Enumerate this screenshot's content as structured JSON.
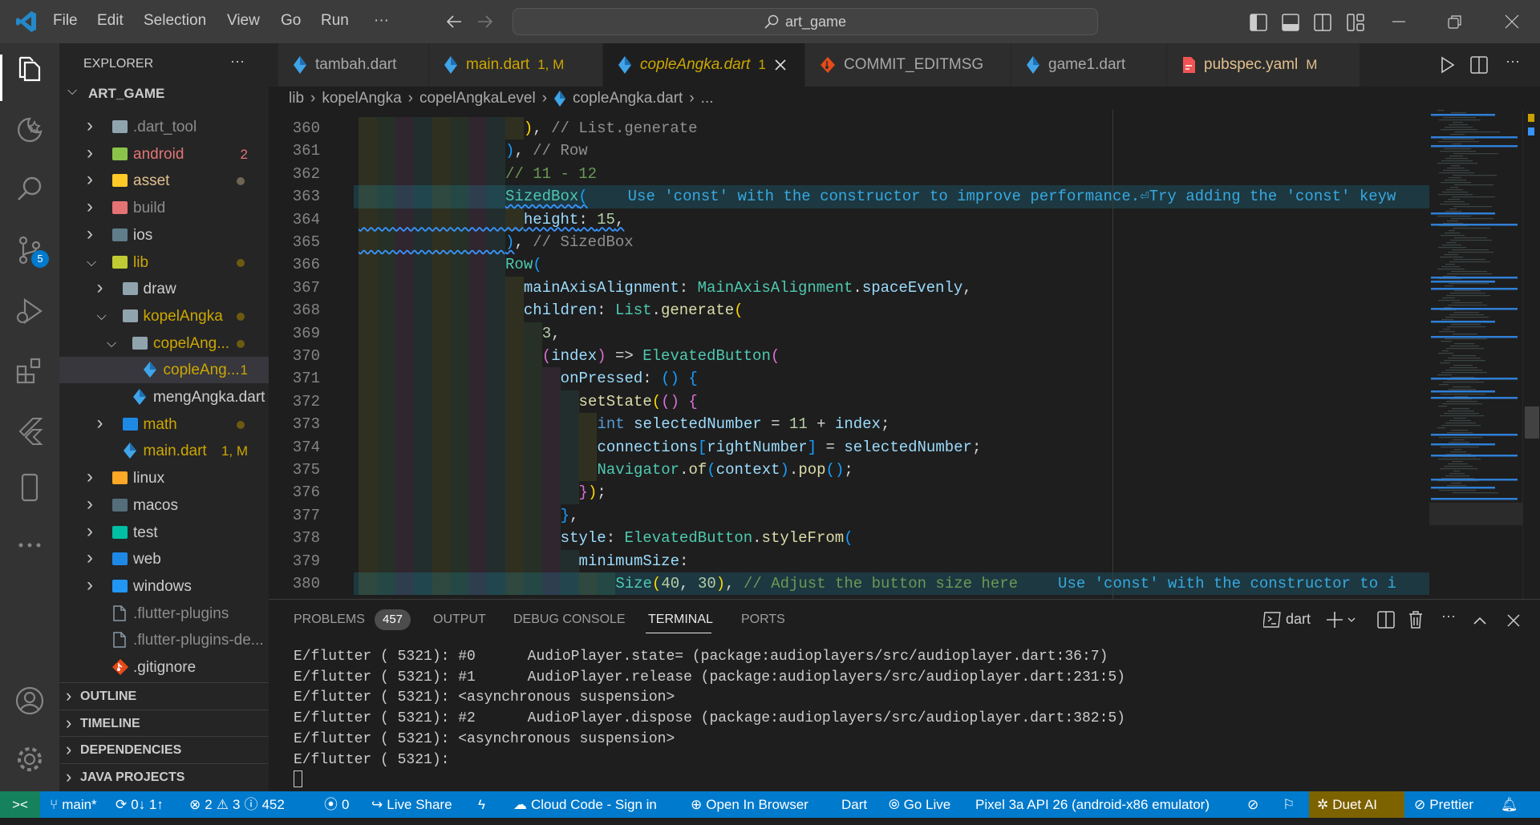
{
  "title_bar": {
    "menu": [
      "File",
      "Edit",
      "Selection",
      "View",
      "Go",
      "Run",
      "···"
    ],
    "search_text": "art_game",
    "icons": [
      "back-arrow-icon",
      "forward-arrow-icon",
      "toggle-primary-sidebar-icon",
      "toggle-panel-icon",
      "toggle-secondary-sidebar-icon",
      "customize-layout-icon",
      "minimize-icon",
      "restore-icon",
      "close-icon"
    ]
  },
  "activity_bar": {
    "items": [
      {
        "icon": "explorer-icon",
        "active": true
      },
      {
        "icon": "remote-explorer-icon"
      },
      {
        "icon": "search-icon"
      },
      {
        "icon": "source-control-icon",
        "badge": "5"
      },
      {
        "icon": "run-debug-icon"
      },
      {
        "icon": "extensions-icon"
      },
      {
        "icon": "flutter-icon"
      },
      {
        "icon": "device-icon"
      },
      {
        "icon": "more-icon"
      },
      {
        "icon": "account-icon"
      },
      {
        "icon": "settings-gear-icon"
      }
    ]
  },
  "sidebar": {
    "title": "EXPLORER",
    "more": "···",
    "root": "ART_GAME",
    "tree": [
      {
        "label": ".dart_tool",
        "level": 0,
        "type": "folder",
        "expanded": false,
        "color": "#8c8c8c",
        "icon_color": "#90a4ae"
      },
      {
        "label": "android",
        "level": 0,
        "type": "folder",
        "expanded": false,
        "color": "#e37575",
        "icon_color": "#8bc34a",
        "badge": "2",
        "badge_color": "#e37575"
      },
      {
        "label": "asset",
        "level": 0,
        "type": "folder",
        "expanded": false,
        "color": "#e2c08d",
        "icon_color": "#ffca28",
        "dot": "#6e6552"
      },
      {
        "label": "build",
        "level": 0,
        "type": "folder",
        "expanded": false,
        "color": "#8c8c8c",
        "icon_color": "#e57373"
      },
      {
        "label": "ios",
        "level": 0,
        "type": "folder",
        "expanded": false,
        "color": "#cccccc",
        "icon_color": "#607d8b"
      },
      {
        "label": "lib",
        "level": 0,
        "type": "folder",
        "expanded": true,
        "color": "#cca700",
        "icon_color": "#c0ca33",
        "dot": "#6b5a10"
      },
      {
        "label": "draw",
        "level": 1,
        "type": "folder",
        "expanded": false,
        "color": "#cccccc",
        "icon_color": "#90a4ae"
      },
      {
        "label": "kopelAngka",
        "level": 1,
        "type": "folder",
        "expanded": true,
        "color": "#cca700",
        "icon_color": "#90a4ae",
        "dot": "#6b5a10"
      },
      {
        "label": "copelAng...",
        "level": 2,
        "type": "folder",
        "expanded": true,
        "color": "#cca700",
        "icon_color": "#90a4ae",
        "dot": "#6b5a10"
      },
      {
        "label": "copleAng...",
        "level": 3,
        "type": "dart",
        "color": "#cca700",
        "badge": "1",
        "badge_color": "#cca700",
        "selected": true
      },
      {
        "label": "mengAngka.dart",
        "level": 2,
        "type": "dart",
        "color": "#cccccc"
      },
      {
        "label": "math",
        "level": 1,
        "type": "folder",
        "expanded": false,
        "color": "#cca700",
        "icon_color": "#1e88e5",
        "dot": "#6b5a10"
      },
      {
        "label": "main.dart",
        "level": 1,
        "type": "dart",
        "color": "#cca700",
        "badge": "1, M",
        "badge_color": "#cca700"
      },
      {
        "label": "linux",
        "level": 0,
        "type": "folder",
        "expanded": false,
        "color": "#cccccc",
        "icon_color": "#ffa726"
      },
      {
        "label": "macos",
        "level": 0,
        "type": "folder",
        "expanded": false,
        "color": "#cccccc",
        "icon_color": "#546e7a"
      },
      {
        "label": "test",
        "level": 0,
        "type": "folder",
        "expanded": false,
        "color": "#cccccc",
        "icon_color": "#00bfa5"
      },
      {
        "label": "web",
        "level": 0,
        "type": "folder",
        "expanded": false,
        "color": "#cccccc",
        "icon_color": "#1e88e5"
      },
      {
        "label": "windows",
        "level": 0,
        "type": "folder",
        "expanded": false,
        "color": "#cccccc",
        "icon_color": "#2196f3"
      },
      {
        "label": ".flutter-plugins",
        "level": 0,
        "type": "file",
        "color": "#8c8c8c"
      },
      {
        "label": ".flutter-plugins-de...",
        "level": 0,
        "type": "file",
        "color": "#8c8c8c"
      },
      {
        "label": ".gitignore",
        "level": 0,
        "type": "git",
        "color": "#cccccc"
      }
    ],
    "sections": [
      "OUTLINE",
      "TIMELINE",
      "DEPENDENCIES",
      "JAVA PROJECTS"
    ]
  },
  "tabs": [
    {
      "label": "tambah.dart",
      "icon": "dart-icon",
      "color": "#a8a8a8"
    },
    {
      "label": "main.dart",
      "status": "1, M",
      "icon": "dart-icon",
      "color": "#cca700"
    },
    {
      "label": "copleAngka.dart",
      "status": "1",
      "icon": "dart-icon",
      "color": "#cca700",
      "active": true
    },
    {
      "label": "COMMIT_EDITMSG",
      "icon": "git-icon",
      "color": "#a8a8a8"
    },
    {
      "label": "game1.dart",
      "icon": "dart-icon",
      "color": "#a8a8a8"
    },
    {
      "label": "pubspec.yaml",
      "status": "M",
      "icon": "yaml-file-icon",
      "color": "#e2c08d"
    }
  ],
  "breadcrumb": [
    "lib",
    "kopelAngka",
    "copelAngkaLevel",
    "copleAngka.dart",
    "..."
  ],
  "editor": {
    "lines": [
      {
        "n": "360",
        "indent": 18,
        "tokens": [
          [
            ")",
            "b1"
          ],
          [
            ", ",
            "d"
          ],
          [
            "// List.generate",
            "lb"
          ]
        ]
      },
      {
        "n": "361",
        "indent": 16,
        "tokens": [
          [
            ")",
            "b3"
          ],
          [
            ", ",
            "d"
          ],
          [
            "// Row",
            "lb"
          ]
        ]
      },
      {
        "n": "362",
        "indent": 16,
        "tokens": [
          [
            "// 11 - 12",
            "cm"
          ]
        ]
      },
      {
        "n": "363",
        "indent": 16,
        "highlight": true,
        "tokens": [
          [
            "SizedBox",
            "c",
            true
          ],
          [
            "(",
            "b3",
            true
          ]
        ],
        "hint": "Use 'const' with the constructor to improve performance.⏎Try adding the 'const' keyw"
      },
      {
        "n": "364",
        "indent": 18,
        "squiggle_indent": true,
        "tokens": [
          [
            "height",
            "p",
            true
          ],
          [
            ": ",
            "d",
            true
          ],
          [
            "15",
            "n",
            true
          ],
          [
            ",",
            "d",
            true
          ]
        ]
      },
      {
        "n": "365",
        "indent": 16,
        "squiggle_indent": true,
        "tokens": [
          [
            ")",
            "b3",
            true
          ],
          [
            ", ",
            "d"
          ],
          [
            "// SizedBox",
            "lb"
          ]
        ]
      },
      {
        "n": "366",
        "indent": 16,
        "tokens": [
          [
            "Row",
            "c"
          ],
          [
            "(",
            "b3"
          ]
        ]
      },
      {
        "n": "367",
        "indent": 18,
        "tokens": [
          [
            "mainAxisAlignment",
            "p"
          ],
          [
            ": ",
            "d"
          ],
          [
            "MainAxisAlignment",
            "c"
          ],
          [
            ".",
            "d"
          ],
          [
            "spaceEvenly",
            "p"
          ],
          [
            ",",
            "d"
          ]
        ]
      },
      {
        "n": "368",
        "indent": 18,
        "tokens": [
          [
            "children",
            "p"
          ],
          [
            ": ",
            "d"
          ],
          [
            "List",
            "c"
          ],
          [
            ".",
            "d"
          ],
          [
            "generate",
            "f"
          ],
          [
            "(",
            "b1"
          ]
        ]
      },
      {
        "n": "369",
        "indent": 20,
        "tokens": [
          [
            "3",
            "n"
          ],
          [
            ",",
            "d"
          ]
        ]
      },
      {
        "n": "370",
        "indent": 20,
        "tokens": [
          [
            "(",
            "b2"
          ],
          [
            "index",
            "p"
          ],
          [
            ")",
            "b2"
          ],
          [
            " => ",
            "d"
          ],
          [
            "ElevatedButton",
            "c"
          ],
          [
            "(",
            "b2"
          ]
        ]
      },
      {
        "n": "371",
        "indent": 22,
        "tokens": [
          [
            "onPressed",
            "p"
          ],
          [
            ": ",
            "d"
          ],
          [
            "()",
            "b3"
          ],
          [
            " ",
            "d"
          ],
          [
            "{",
            "b3"
          ]
        ]
      },
      {
        "n": "372",
        "indent": 24,
        "tokens": [
          [
            "setState",
            "f"
          ],
          [
            "(",
            "b1"
          ],
          [
            "()",
            "b2"
          ],
          [
            " ",
            "d"
          ],
          [
            "{",
            "b2"
          ]
        ]
      },
      {
        "n": "373",
        "indent": 26,
        "tokens": [
          [
            "int",
            "k"
          ],
          [
            " ",
            "d"
          ],
          [
            "selectedNumber",
            "p"
          ],
          [
            " = ",
            "d"
          ],
          [
            "11",
            "n"
          ],
          [
            " + ",
            "d"
          ],
          [
            "index",
            "p"
          ],
          [
            ";",
            "d"
          ]
        ]
      },
      {
        "n": "374",
        "indent": 26,
        "tokens": [
          [
            "connections",
            "p"
          ],
          [
            "[",
            "b3"
          ],
          [
            "rightNumber",
            "p"
          ],
          [
            "]",
            "b3"
          ],
          [
            " = ",
            "d"
          ],
          [
            "selectedNumber",
            "p"
          ],
          [
            ";",
            "d"
          ]
        ]
      },
      {
        "n": "375",
        "indent": 26,
        "tokens": [
          [
            "Navigator",
            "c"
          ],
          [
            ".",
            "d"
          ],
          [
            "of",
            "f"
          ],
          [
            "(",
            "b3"
          ],
          [
            "context",
            "p"
          ],
          [
            ")",
            "b3"
          ],
          [
            ".",
            "d"
          ],
          [
            "pop",
            "f"
          ],
          [
            "()",
            "b3"
          ],
          [
            ";",
            "d"
          ]
        ]
      },
      {
        "n": "376",
        "indent": 24,
        "tokens": [
          [
            "}",
            "b2"
          ],
          [
            ")",
            "b1"
          ],
          [
            ";",
            "d"
          ]
        ]
      },
      {
        "n": "377",
        "indent": 22,
        "tokens": [
          [
            "}",
            "b3"
          ],
          [
            ",",
            "d"
          ]
        ]
      },
      {
        "n": "378",
        "indent": 22,
        "tokens": [
          [
            "style",
            "p"
          ],
          [
            ": ",
            "d"
          ],
          [
            "ElevatedButton",
            "c"
          ],
          [
            ".",
            "d"
          ],
          [
            "styleFrom",
            "f"
          ],
          [
            "(",
            "b3"
          ]
        ]
      },
      {
        "n": "379",
        "indent": 24,
        "tokens": [
          [
            "minimumSize",
            "p"
          ],
          [
            ":",
            "d"
          ]
        ]
      },
      {
        "n": "380",
        "indent": 28,
        "highlight": true,
        "tokens": [
          [
            "Size",
            "c"
          ],
          [
            "(",
            "b1"
          ],
          [
            "40",
            "n"
          ],
          [
            ", ",
            "d"
          ],
          [
            "30",
            "n"
          ],
          [
            ")",
            "b1"
          ],
          [
            ", ",
            "d"
          ],
          [
            "// Adjust the button size here",
            "cm"
          ]
        ],
        "hint": "Use 'const' with the constructor to i"
      }
    ],
    "actions": [
      "run-icon",
      "split-editor-icon",
      "more-actions-icon"
    ]
  },
  "panel": {
    "tabs": [
      {
        "label": "PROBLEMS",
        "badge": "457"
      },
      {
        "label": "OUTPUT"
      },
      {
        "label": "DEBUG CONSOLE"
      },
      {
        "label": "TERMINAL",
        "active": true
      },
      {
        "label": "PORTS"
      }
    ],
    "terminal_name": "dart",
    "terminal_lines": [
      "E/flutter ( 5321): #0      AudioPlayer.state= (package:audioplayers/src/audioplayer.dart:36:7)",
      "E/flutter ( 5321): #1      AudioPlayer.release (package:audioplayers/src/audioplayer.dart:231:5)",
      "E/flutter ( 5321): <asynchronous suspension>",
      "E/flutter ( 5321): #2      AudioPlayer.dispose (package:audioplayers/src/audioplayer.dart:382:5)",
      "E/flutter ( 5321): <asynchronous suspension>",
      "E/flutter ( 5321):"
    ]
  },
  "status_bar": {
    "remote": "><",
    "branch": "main*",
    "sync": "0↓ 1↑",
    "errors": "2",
    "warnings": "3",
    "infos": "452",
    "ports": "0",
    "live_share": "Live Share",
    "cloud_code": "Cloud Code - Sign in",
    "open_browser": "Open In Browser",
    "language": "Dart",
    "go_live": "Go Live",
    "device": "Pixel 3a API 26 (android-x86 emulator)",
    "duet": "Duet AI",
    "prettier": "Prettier",
    "colors": {
      "bar": "#007acc",
      "remote": "#16825d",
      "duet": "#7d6200"
    }
  }
}
